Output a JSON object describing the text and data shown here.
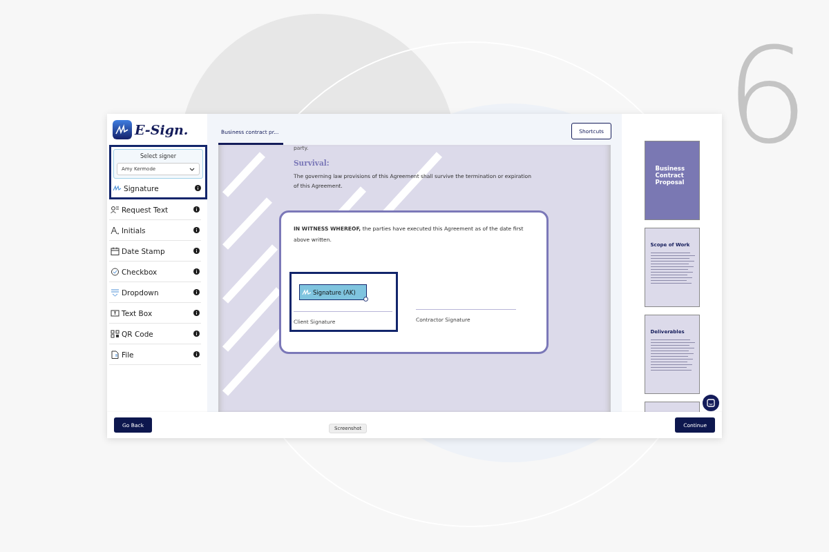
{
  "backdrop": {
    "step_number": "6"
  },
  "logo": {
    "text": "E-Sign."
  },
  "signer": {
    "label": "Select signer",
    "value": "Amy Kermode"
  },
  "fields": [
    {
      "kind": "signature",
      "label": "Signature",
      "selected": true
    },
    {
      "kind": "request-text",
      "label": "Request Text",
      "selected": false
    },
    {
      "kind": "initials",
      "label": "Initials",
      "selected": false
    },
    {
      "kind": "date",
      "label": "Date Stamp",
      "selected": false
    },
    {
      "kind": "checkbox",
      "label": "Checkbox",
      "selected": false
    },
    {
      "kind": "dropdown",
      "label": "Dropdown",
      "selected": false
    },
    {
      "kind": "textbox",
      "label": "Text Box",
      "selected": false
    },
    {
      "kind": "qr",
      "label": "QR Code",
      "selected": false
    },
    {
      "kind": "file",
      "label": "File",
      "selected": false
    }
  ],
  "tabs": [
    {
      "label": "Business contract pr...",
      "selected": true
    }
  ],
  "shortcuts_button": "Shortcuts",
  "document": {
    "cut_line": "party.",
    "heading": "Survival:",
    "paragraph": "The governing law provisions of this Agreement shall survive the termination or expiration of this Agreement.",
    "witness": "**IN WITNESS WHEREOF,** the parties have executed this Agreement as of the date first above written.",
    "signature_field": "Signature (AK)",
    "client_label": "Client Signature",
    "contractor_label": "Contractor Signature"
  },
  "thumbnails": [
    {
      "kind": "cover",
      "title": "Business Contract Proposal"
    },
    {
      "kind": "page",
      "title": "Scope of Work"
    },
    {
      "kind": "page",
      "title": "Deliverables"
    },
    {
      "kind": "partial"
    }
  ],
  "footer": {
    "back": "Go Back",
    "tooltip": "Screenshot",
    "continue": "Continue"
  }
}
